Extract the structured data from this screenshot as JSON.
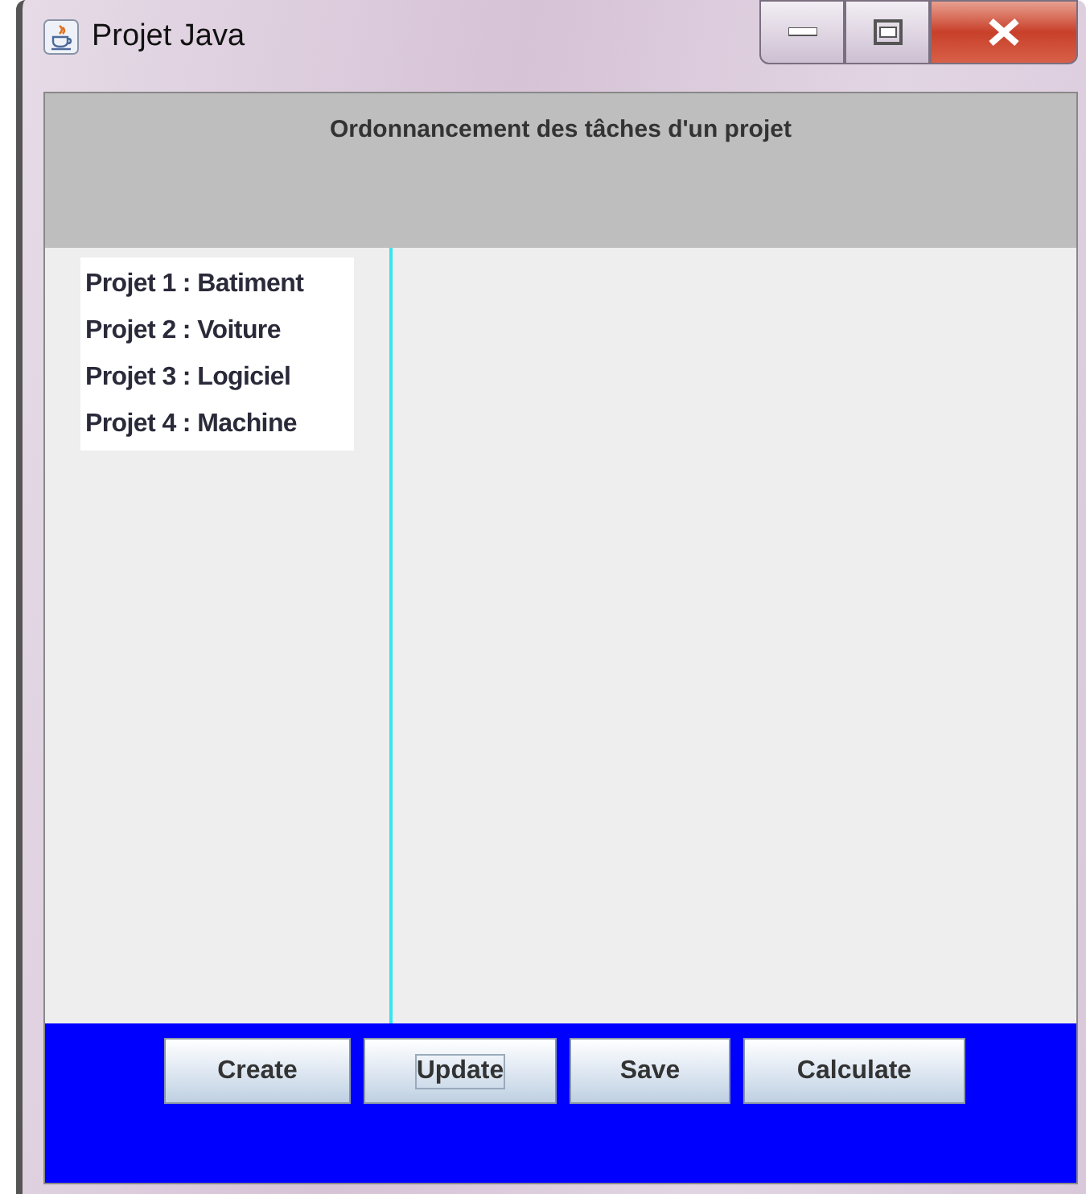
{
  "window": {
    "title": "Projet Java"
  },
  "header": {
    "title": "Ordonnancement des tâches d'un projet"
  },
  "projects": [
    "Projet 1 : Batiment",
    "Projet 2 : Voiture",
    "Projet 3 : Logiciel",
    "Projet 4 : Machine"
  ],
  "buttons": [
    {
      "label": "Create",
      "focused": false
    },
    {
      "label": "Update",
      "focused": true
    },
    {
      "label": "Save",
      "focused": false
    },
    {
      "label": "Calculate",
      "focused": false
    }
  ]
}
